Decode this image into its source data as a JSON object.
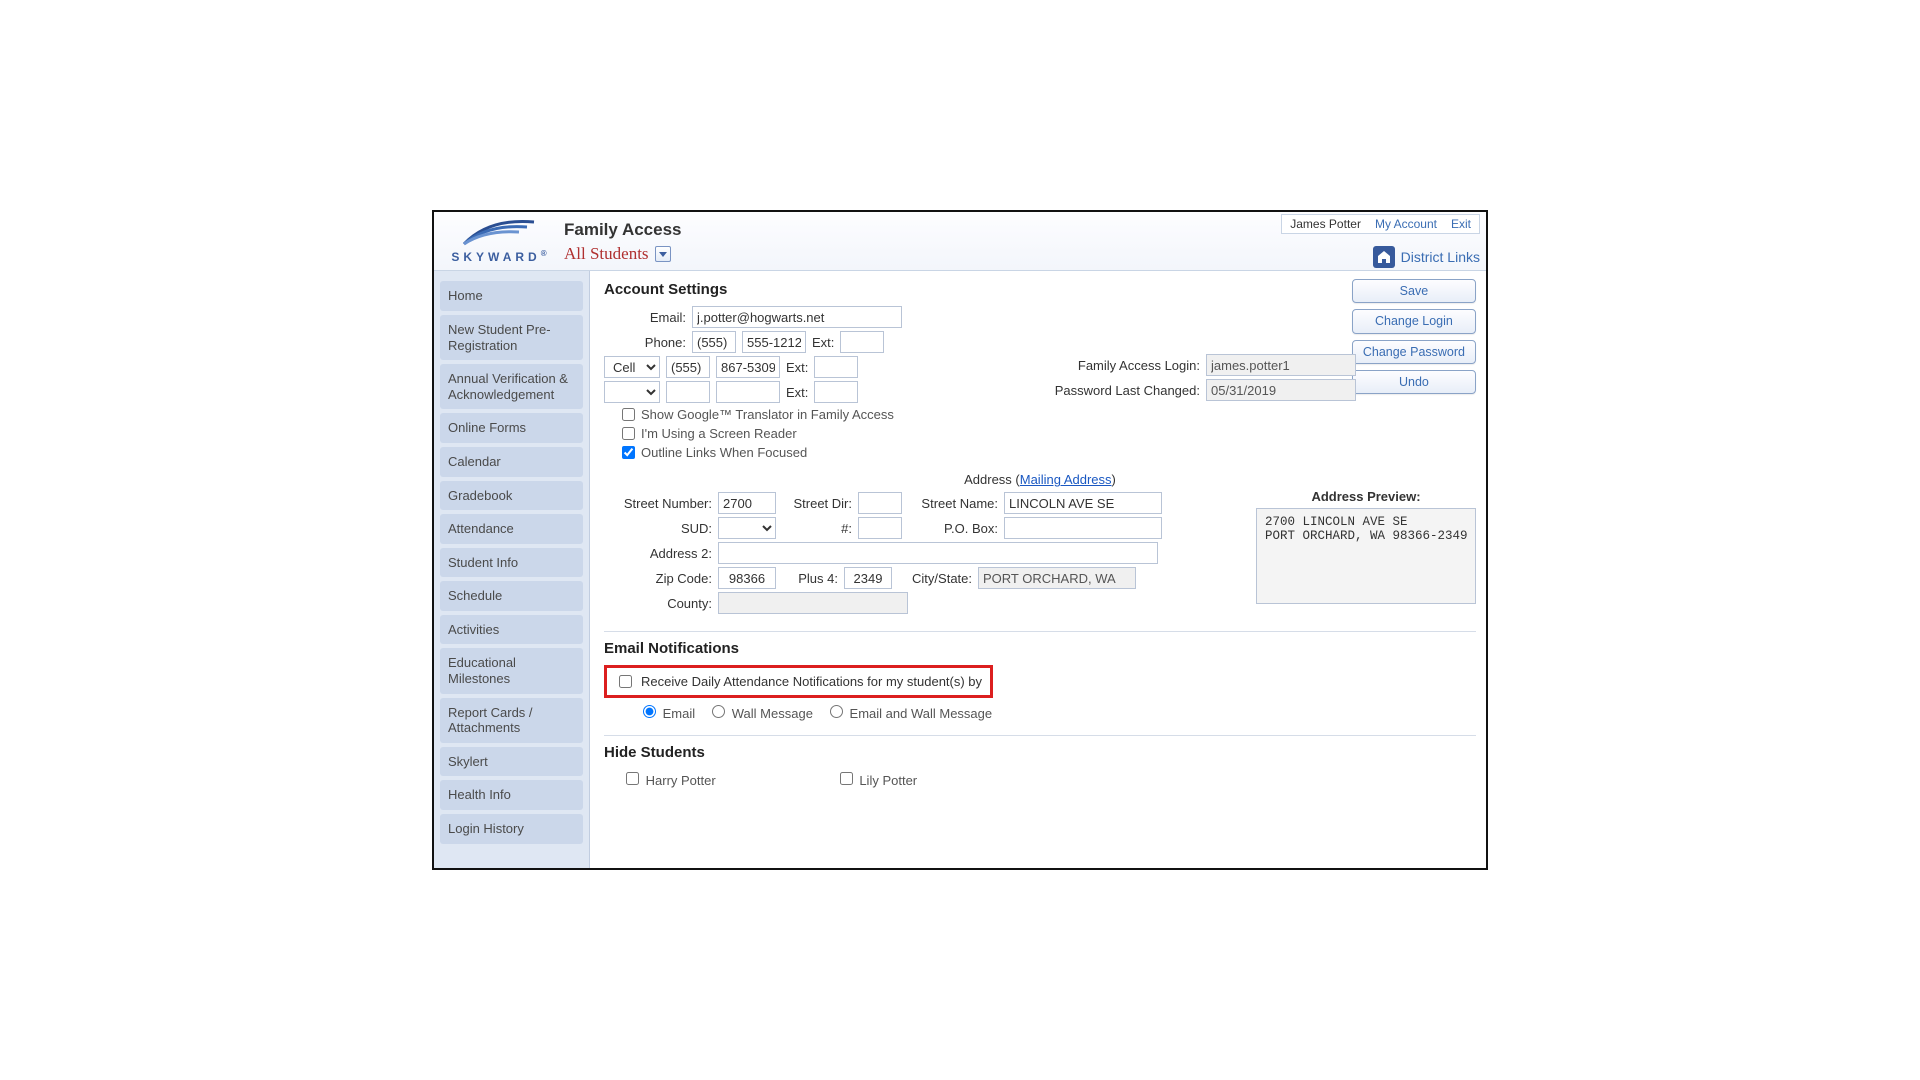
{
  "header": {
    "app_title": "Family Access",
    "student_selector": "All Students",
    "user_name": "James Potter",
    "my_account": "My Account",
    "exit": "Exit",
    "district_links": "District Links",
    "logo_text": "SKYWARD"
  },
  "sidebar": {
    "items": [
      "Home",
      "New Student Pre-Registration",
      "Annual Verification & Acknowledgement",
      "Online Forms",
      "Calendar",
      "Gradebook",
      "Attendance",
      "Student Info",
      "Schedule",
      "Activities",
      "Educational Milestones",
      "Report Cards / Attachments",
      "Skylert",
      "Health Info",
      "Login History"
    ]
  },
  "actions": {
    "save": "Save",
    "change_login": "Change Login",
    "change_password": "Change Password",
    "undo": "Undo"
  },
  "account": {
    "title": "Account Settings",
    "labels": {
      "email": "Email:",
      "phone": "Phone:",
      "ext": "Ext:",
      "fa_login": "Family Access Login:",
      "pw_changed": "Password Last Changed:"
    },
    "email": "j.potter@hogwarts.net",
    "phone_area": "(555)",
    "phone_num": "555-1212",
    "phone_ext": "",
    "phone2_type": "Cell",
    "phone2_area": "(555)",
    "phone2_num": "867-5309",
    "phone2_ext": "",
    "phone3_type": "",
    "phone3_area": "",
    "phone3_num": "",
    "phone3_ext": "",
    "login": "james.potter1",
    "pw_changed": "05/31/2019",
    "checks": {
      "google": "Show Google™ Translator in Family Access",
      "screen_reader": "I'm Using a Screen Reader",
      "outline": "Outline Links When Focused"
    }
  },
  "address": {
    "heading_prefix": "Address (",
    "mailing_link": "Mailing Address",
    "heading_suffix": ")",
    "labels": {
      "street_number": "Street Number:",
      "street_dir": "Street Dir:",
      "street_name": "Street Name:",
      "sud": "SUD:",
      "hash": "#:",
      "pobox": "P.O. Box:",
      "address2": "Address 2:",
      "zip": "Zip Code:",
      "plus4": "Plus 4:",
      "city_state": "City/State:",
      "county": "County:",
      "preview": "Address Preview:"
    },
    "street_number": "2700",
    "street_dir": "",
    "street_name": "LINCOLN AVE SE",
    "sud": "",
    "hash": "",
    "pobox": "",
    "address2": "",
    "zip": "98366",
    "plus4": "2349",
    "city_state": "PORT ORCHARD, WA",
    "county": "",
    "preview_line1": "2700 LINCOLN AVE SE",
    "preview_line2": "PORT ORCHARD, WA 98366-2349"
  },
  "notifications": {
    "title": "Email Notifications",
    "receive": "Receive Daily Attendance Notifications for my student(s) by",
    "opt_email": "Email",
    "opt_wall": "Wall Message",
    "opt_both": "Email and Wall Message"
  },
  "hide": {
    "title": "Hide Students",
    "student1": "Harry Potter",
    "student2": "Lily Potter"
  }
}
